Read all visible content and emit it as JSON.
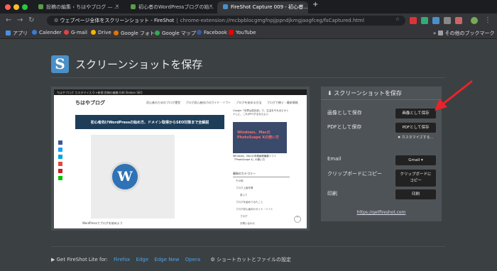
{
  "browser": {
    "tabs": [
      {
        "title": "投稿の編集 ‹ ちはやブログ — ..."
      },
      {
        "title": "初心者のWordPressブログの始..."
      },
      {
        "title": "FireShot Capture 009 - 初心者..."
      }
    ],
    "new_tab": "+",
    "address_title": "ウェブページ全体をスクリーンショット - FireShot",
    "address_url": "chrome-extension://mcbpblocgmgfnpjjppndjkmgjaogfceg/fsCaptured.html"
  },
  "bookmarks": {
    "items": [
      "アプリ",
      "Calender",
      "G-mail",
      "Drive",
      "Google フォト",
      "Google マップ",
      "Facebook",
      "YouTube"
    ],
    "other": "その他のブックマーク"
  },
  "page": {
    "title": "スクリーンショットを保存"
  },
  "preview": {
    "wp_bar": "ちはやブログ   カスタマイズ   0   +新規   投稿の編集   Edit   Broken   SEO",
    "blog_name": "ちはやブログ",
    "nav": "初心者のためのブログ運営 ブログ初心者向けのガイド・ソフト ブログを始める方法 ブログで稼ぐ・最新情報",
    "headline": "初心者向けWordPressの始め方、ドメイン取得からSEO対策まで全解説",
    "caption": "WordPressでブログを始めよう",
    "side_text": "Google「世界は変化前」で、生活をそれほどオトナしに、これがFOするならよい",
    "side_image": "Windows、MacのPhotoScape Xの使い方",
    "side_caption": "Windows、Macの本格画像編集ソフト「PhotoScape X」の使い方",
    "cat_head": "最新のカテゴリー",
    "cats": [
      "その他",
      "ブログ上級作業",
      "書いて",
      "ブログを始めてみたこと",
      "ブログ初心者向けガイド・ソフト",
      "ブログ",
      "お問い合わせ"
    ],
    "back_top": "^"
  },
  "panel": {
    "header": "スクリーンショットを保存",
    "image_label": "画像として保存",
    "image_button": "画像として保存",
    "pdf_label": "PDFとして保存",
    "pdf_button": "PDFとして保存",
    "pdf_note": "カスタマイズする...",
    "email_label": "Email",
    "email_button": "Gmail ▾",
    "clip_label": "クリップボードにコピー",
    "clip_button_1": "クリップボードに",
    "clip_button_2": "コピー",
    "print_label": "印刷",
    "print_button": "印刷",
    "link": "https://getfireshot.com"
  },
  "footer": {
    "prefix": "Get FireShot Lite for:",
    "links": [
      "Firefox",
      "Edge",
      "Edge New",
      "Opera"
    ],
    "shortcuts": "ショートカットとファイルの設定"
  },
  "colors": {
    "accent_link": "#4ea3e8",
    "arrow": "#e8242a",
    "logo": "#4a90c8"
  }
}
